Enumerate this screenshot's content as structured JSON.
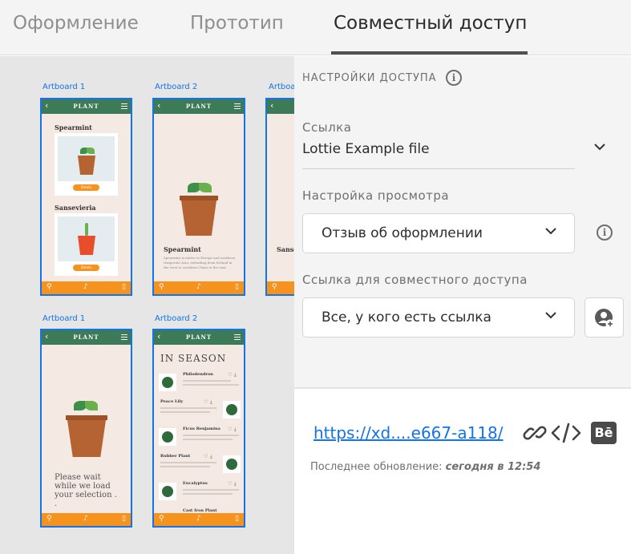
{
  "tabs": [
    {
      "label": "Оформление",
      "active": false
    },
    {
      "label": "Прототип",
      "active": false
    },
    {
      "label": "Совместный доступ",
      "active": true
    }
  ],
  "canvas": {
    "artboards": [
      {
        "label": "Artboard 1",
        "brand": "PLANT",
        "items": [
          "Spearmint",
          "Sansevieria"
        ],
        "button": "Details"
      },
      {
        "label": "Artboard 2",
        "brand": "PLANT",
        "name": "Spearmint",
        "text": "Spearmint is native to Europe and southern temperate Asia, extending from Ireland in the west to southern China in the east."
      },
      {
        "label": "Artboard",
        "name": "Sanse"
      },
      {
        "label": "Artboard 1",
        "brand": "PLANT",
        "wait_text": "Please wait while we load your selection . ."
      },
      {
        "label": "Artboard 2",
        "brand": "PLANT",
        "heading": "IN SEASON",
        "list": [
          "Philodendron",
          "Peace Lily",
          "Ficus Benjamina",
          "Rubber Plant",
          "Eucalyptus",
          "Cast Iron Plant"
        ]
      }
    ]
  },
  "panel": {
    "section_title": "НАСТРОЙКИ ДОСТУПА",
    "link_label": "Ссылка",
    "link_value": "Lottie Example file",
    "view_label": "Настройка просмотра",
    "view_value": "Отзыв об оформлении",
    "share_label": "Ссылка для совместного доступа",
    "share_value": "Все, у кого есть ссылка"
  },
  "bottom": {
    "url": "https://xd....e667-a118/",
    "updated_prefix": "Последнее обновление: ",
    "updated_value": "сегодня в 12:54",
    "icons": [
      "link-icon",
      "embed-code-icon",
      "behance-icon"
    ],
    "behance": "Bē"
  },
  "colors": {
    "accent_blue": "#1473e6",
    "plant_green": "#3d7a57",
    "plant_orange": "#f6921e"
  }
}
